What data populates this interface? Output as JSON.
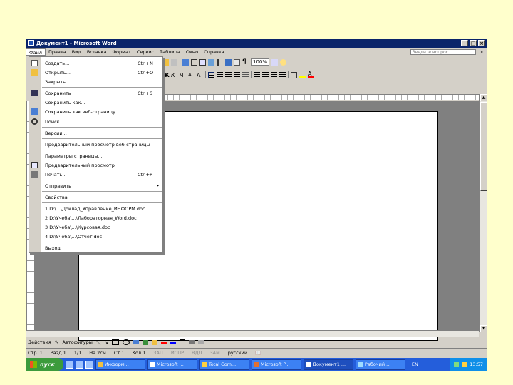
{
  "window": {
    "title": "Документ1 - Microsoft Word",
    "controls": {
      "minimize": "_",
      "maximize": "□",
      "close": "×"
    }
  },
  "menubar": {
    "items": [
      "Файл",
      "Правка",
      "Вид",
      "Вставка",
      "Формат",
      "Сервис",
      "Таблица",
      "Окно",
      "Справка"
    ],
    "help_placeholder": "Введите вопрос",
    "close_doc": "×"
  },
  "toolbar": {
    "zoom": "100%",
    "format_marks": "¶"
  },
  "file_menu": {
    "items": [
      {
        "label": "Создать...",
        "shortcut": "Ctrl+N",
        "icon": "new-document-icon"
      },
      {
        "label": "Открыть...",
        "shortcut": "Ctrl+O",
        "icon": "open-folder-icon"
      },
      {
        "label": "Закрыть",
        "shortcut": "",
        "icon": ""
      },
      {
        "label": "Сохранить",
        "shortcut": "Ctrl+S",
        "icon": "save-disk-icon"
      },
      {
        "label": "Сохранить как...",
        "shortcut": "",
        "icon": ""
      },
      {
        "label": "Сохранить как веб-страницу...",
        "shortcut": "",
        "icon": "web-page-icon"
      },
      {
        "label": "Поиск...",
        "shortcut": "",
        "icon": "search-icon"
      },
      {
        "label": "Версии...",
        "shortcut": "",
        "icon": ""
      },
      {
        "label": "Предварительный просмотр веб-страницы",
        "shortcut": "",
        "icon": ""
      },
      {
        "label": "Параметры страницы...",
        "shortcut": "",
        "icon": ""
      },
      {
        "label": "Предварительный просмотр",
        "shortcut": "",
        "icon": "print-preview-icon"
      },
      {
        "label": "Печать...",
        "shortcut": "Ctrl+P",
        "icon": "printer-icon"
      },
      {
        "label": "Отправить",
        "shortcut": "",
        "icon": "",
        "submenu": "▸"
      },
      {
        "label": "Свойства",
        "shortcut": "",
        "icon": ""
      },
      {
        "label": "1 D:\\...\\Доклад_Управление_ИНФОРМ.doc",
        "shortcut": "",
        "icon": ""
      },
      {
        "label": "2 D:\\Учеба\\...\\Лабораторная_Word.doc",
        "shortcut": "",
        "icon": ""
      },
      {
        "label": "3 D:\\Учеба\\...\\Курсовая.doc",
        "shortcut": "",
        "icon": ""
      },
      {
        "label": "4 D:\\Учеба\\...\\Отчет.doc",
        "shortcut": "",
        "icon": ""
      },
      {
        "label": "Выход",
        "shortcut": "",
        "icon": ""
      }
    ]
  },
  "drawbar": {
    "actions": "Действия",
    "autoshapes": "Автофигуры"
  },
  "statusbar": {
    "page": "Стр. 1",
    "section": "Разд 1",
    "pages": "1/1",
    "position": "На 2см",
    "line": "Ст 1",
    "column": "Кол 1",
    "modes": [
      "ЗАП",
      "ИСПР",
      "ВДЛ",
      "ЗАМ"
    ],
    "language": "русский"
  },
  "taskbar": {
    "start": "пуск",
    "tasks": [
      "Информ...",
      "Microsoft ...",
      "Total Com...",
      "Microsoft P...",
      "Документ1 ...",
      "Рабочий ..."
    ],
    "lang": "EN",
    "clock": "13:57"
  }
}
